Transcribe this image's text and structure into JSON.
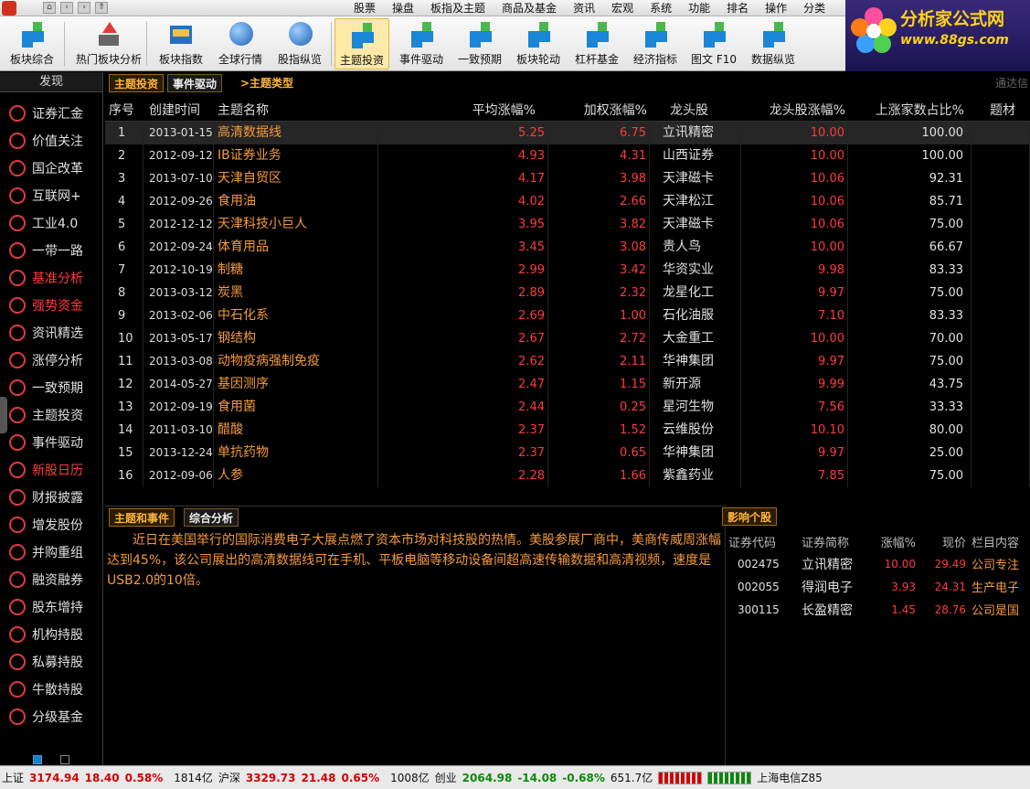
{
  "menu": [
    "股票",
    "操盘",
    "板指及主题",
    "商品及基金",
    "资讯",
    "宏观",
    "系统",
    "功能",
    "排名",
    "操作",
    "分类"
  ],
  "toolbar": [
    {
      "label": "板块综合",
      "icon": "squares-icon"
    },
    {
      "label": "热门板块分析",
      "icon": "arrow-up-icon"
    },
    {
      "label": "板块指数",
      "icon": "chart-icon"
    },
    {
      "label": "全球行情",
      "icon": "globe-icon"
    },
    {
      "label": "股指纵览",
      "icon": "globe-icon"
    },
    {
      "label": "主题投资",
      "icon": "squares-icon"
    },
    {
      "label": "事件驱动",
      "icon": "squares-icon"
    },
    {
      "label": "一致预期",
      "icon": "squares-icon"
    },
    {
      "label": "板块轮动",
      "icon": "squares-icon"
    },
    {
      "label": "杠杆基金",
      "icon": "squares-icon"
    },
    {
      "label": "经济指标",
      "icon": "squares-icon"
    },
    {
      "label": "图文 F10",
      "icon": "squares-icon"
    },
    {
      "label": "数据纵览",
      "icon": "squares-icon"
    }
  ],
  "brand": {
    "title": "分析家公式网",
    "url": "www.88gs.com"
  },
  "sidebar": {
    "title": "发现",
    "items": [
      {
        "label": "证券汇金",
        "hl": false
      },
      {
        "label": "价值关注",
        "hl": false
      },
      {
        "label": "国企改革",
        "hl": false
      },
      {
        "label": "互联网+",
        "hl": false
      },
      {
        "label": "工业4.0",
        "hl": false
      },
      {
        "label": "一带一路",
        "hl": false
      },
      {
        "label": "基准分析",
        "hl": true
      },
      {
        "label": "强势资金",
        "hl": true
      },
      {
        "label": "资讯精选",
        "hl": false
      },
      {
        "label": "涨停分析",
        "hl": false
      },
      {
        "label": "一致预期",
        "hl": false
      },
      {
        "label": "主题投资",
        "hl": false
      },
      {
        "label": "事件驱动",
        "hl": false
      },
      {
        "label": "新股日历",
        "hl": true
      },
      {
        "label": "财报披露",
        "hl": false
      },
      {
        "label": "增发股份",
        "hl": false
      },
      {
        "label": "并购重组",
        "hl": false
      },
      {
        "label": "融资融券",
        "hl": false
      },
      {
        "label": "股东增持",
        "hl": false
      },
      {
        "label": "机构持股",
        "hl": false
      },
      {
        "label": "私募持股",
        "hl": false
      },
      {
        "label": "牛散持股",
        "hl": false
      },
      {
        "label": "分级基金",
        "hl": false
      }
    ]
  },
  "tabs": {
    "theme": "主题投资",
    "event": "事件驱动",
    "type": ">主题类型",
    "right": "通达信"
  },
  "table": {
    "headers": [
      "序号",
      "创建时间",
      "主题名称",
      "平均涨幅%",
      "加权涨幅%",
      "龙头股",
      "龙头股涨幅%",
      "上涨家数占比%",
      "题材"
    ],
    "rows": [
      {
        "idx": "1",
        "date": "2013-01-15",
        "name": "高清数据线",
        "avg": "5.25",
        "wgt": "6.75",
        "lead": "立讯精密",
        "lchg": "10.00",
        "ratio": "100.00"
      },
      {
        "idx": "2",
        "date": "2012-09-12",
        "name": "IB证券业务",
        "avg": "4.93",
        "wgt": "4.31",
        "lead": "山西证券",
        "lchg": "10.00",
        "ratio": "100.00"
      },
      {
        "idx": "3",
        "date": "2013-07-10",
        "name": "天津自贸区",
        "avg": "4.17",
        "wgt": "3.98",
        "lead": "天津磁卡",
        "lchg": "10.06",
        "ratio": "92.31"
      },
      {
        "idx": "4",
        "date": "2012-09-26",
        "name": "食用油",
        "avg": "4.02",
        "wgt": "2.66",
        "lead": "天津松江",
        "lchg": "10.06",
        "ratio": "85.71"
      },
      {
        "idx": "5",
        "date": "2012-12-12",
        "name": "天津科技小巨人",
        "avg": "3.95",
        "wgt": "3.82",
        "lead": "天津磁卡",
        "lchg": "10.06",
        "ratio": "75.00"
      },
      {
        "idx": "6",
        "date": "2012-09-24",
        "name": "体育用品",
        "avg": "3.45",
        "wgt": "3.08",
        "lead": " 贵人鸟",
        "lchg": "10.00",
        "ratio": "66.67"
      },
      {
        "idx": "7",
        "date": "2012-10-19",
        "name": "制糖",
        "avg": "2.99",
        "wgt": "3.42",
        "lead": "华资实业",
        "lchg": "9.98",
        "ratio": "83.33"
      },
      {
        "idx": "8",
        "date": "2013-03-12",
        "name": "炭黑",
        "avg": "2.89",
        "wgt": "2.32",
        "lead": "龙星化工",
        "lchg": "9.97",
        "ratio": "75.00"
      },
      {
        "idx": "9",
        "date": "2013-02-06",
        "name": "中石化系",
        "avg": "2.69",
        "wgt": "1.00",
        "lead": "石化油服",
        "lchg": "7.10",
        "ratio": "83.33"
      },
      {
        "idx": "10",
        "date": "2013-05-17",
        "name": "钢结构",
        "avg": "2.67",
        "wgt": "2.72",
        "lead": "大金重工",
        "lchg": "10.00",
        "ratio": "70.00"
      },
      {
        "idx": "11",
        "date": "2013-03-08",
        "name": "动物疫病强制免疫",
        "avg": "2.62",
        "wgt": "2.11",
        "lead": "华神集团",
        "lchg": "9.97",
        "ratio": "75.00"
      },
      {
        "idx": "12",
        "date": "2014-05-27",
        "name": "基因测序",
        "avg": "2.47",
        "wgt": "1.15",
        "lead": " 新开源",
        "lchg": "9.99",
        "ratio": "43.75"
      },
      {
        "idx": "13",
        "date": "2012-09-19",
        "name": "食用菌",
        "avg": "2.44",
        "wgt": "0.25",
        "lead": "星河生物",
        "lchg": "7.56",
        "ratio": "33.33"
      },
      {
        "idx": "14",
        "date": "2011-03-10",
        "name": "醋酸",
        "avg": "2.37",
        "wgt": "1.52",
        "lead": "云维股份",
        "lchg": "10.10",
        "ratio": "80.00"
      },
      {
        "idx": "15",
        "date": "2013-12-24",
        "name": "单抗药物",
        "avg": "2.37",
        "wgt": "0.65",
        "lead": "华神集团",
        "lchg": "9.97",
        "ratio": "25.00"
      },
      {
        "idx": "16",
        "date": "2012-09-06",
        "name": "人参",
        "avg": "2.28",
        "wgt": "1.66",
        "lead": "紫鑫药业",
        "lchg": "7.85",
        "ratio": "75.00"
      }
    ]
  },
  "bottom": {
    "tab1": "主题和事件",
    "tab2": "综合分析",
    "stock_tab": "影响个股",
    "desc": "近日在美国举行的国际消费电子大展点燃了资本市场对科技股的热情。美股参展厂商中，美商传威周涨幅达到45%，该公司展出的高清数据线可在手机、平板电脑等移动设备间超高速传输数据和高清视频，速度是USB2.0的10倍。",
    "stock_headers": [
      "证券代码",
      "证券简称",
      "涨幅%",
      "现价",
      "栏目内容"
    ],
    "stocks": [
      {
        "code": "002475",
        "name": "立讯精密",
        "chg": "10.00",
        "price": "29.49",
        "col": "公司专注"
      },
      {
        "code": "002055",
        "name": "得润电子",
        "chg": "3.93",
        "price": "24.31",
        "col": "生产电子"
      },
      {
        "code": "300115",
        "name": "长盈精密",
        "chg": "1.45",
        "price": "28.76",
        "col": "公司是国"
      }
    ]
  },
  "status": {
    "sh_label": "上证",
    "sh_val": "3174.94",
    "sh_chg": "18.40",
    "sh_pct": "0.58%",
    "sh_amt": "1814亿",
    "hs_label": "沪深",
    "hs_val": "3329.73",
    "hs_chg": "21.48",
    "hs_pct": "0.65%",
    "hs_amt": "1008亿",
    "cy_label": "创业",
    "cy_val": "2064.98",
    "cy_chg": "-14.08",
    "cy_pct": "-0.68%",
    "cy_amt": "651.7亿",
    "server": "上海电信Z85"
  }
}
